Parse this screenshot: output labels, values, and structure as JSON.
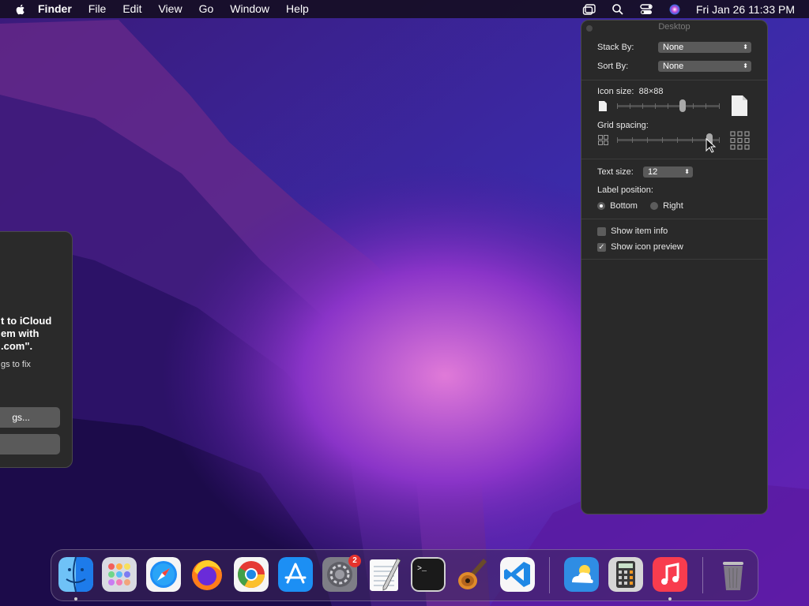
{
  "menubar": {
    "app_name": "Finder",
    "items": [
      "File",
      "Edit",
      "View",
      "Go",
      "Window",
      "Help"
    ],
    "clock": "Fri Jan 26  11:33 PM",
    "status_icons": [
      "window-icon",
      "search-icon",
      "control-center-icon",
      "siri-icon"
    ]
  },
  "panel": {
    "title": "Desktop",
    "stack_by_label": "Stack By:",
    "stack_by_value": "None",
    "sort_by_label": "Sort By:",
    "sort_by_value": "None",
    "icon_size_label": "Icon size:",
    "icon_size_value": "88×88",
    "icon_size_slider_fraction": 0.64,
    "grid_spacing_label": "Grid spacing:",
    "grid_spacing_slider_fraction": 0.9,
    "text_size_label": "Text size:",
    "text_size_value": "12",
    "label_position_label": "Label position:",
    "label_bottom": "Bottom",
    "label_right": "Right",
    "label_position_selected": "Bottom",
    "show_item_info": "Show item info",
    "show_item_info_checked": false,
    "show_icon_preview": "Show icon preview",
    "show_icon_preview_checked": true
  },
  "alert": {
    "line1": "t to iCloud",
    "line2": "em with",
    "line3": ".com\".",
    "sub": "gs to fix",
    "button1": "gs...",
    "button2": ""
  },
  "dock": {
    "apps": [
      "finder-icon",
      "launchpad-icon",
      "safari-icon",
      "firefox-icon",
      "chrome-icon",
      "app-store-icon",
      "system-preferences-icon",
      "textedit-icon",
      "terminal-icon",
      "garageband-icon",
      "vscode-icon",
      "weather-icon",
      "calculator-icon",
      "music-icon",
      "trash-icon"
    ],
    "settings_badge": "2"
  }
}
